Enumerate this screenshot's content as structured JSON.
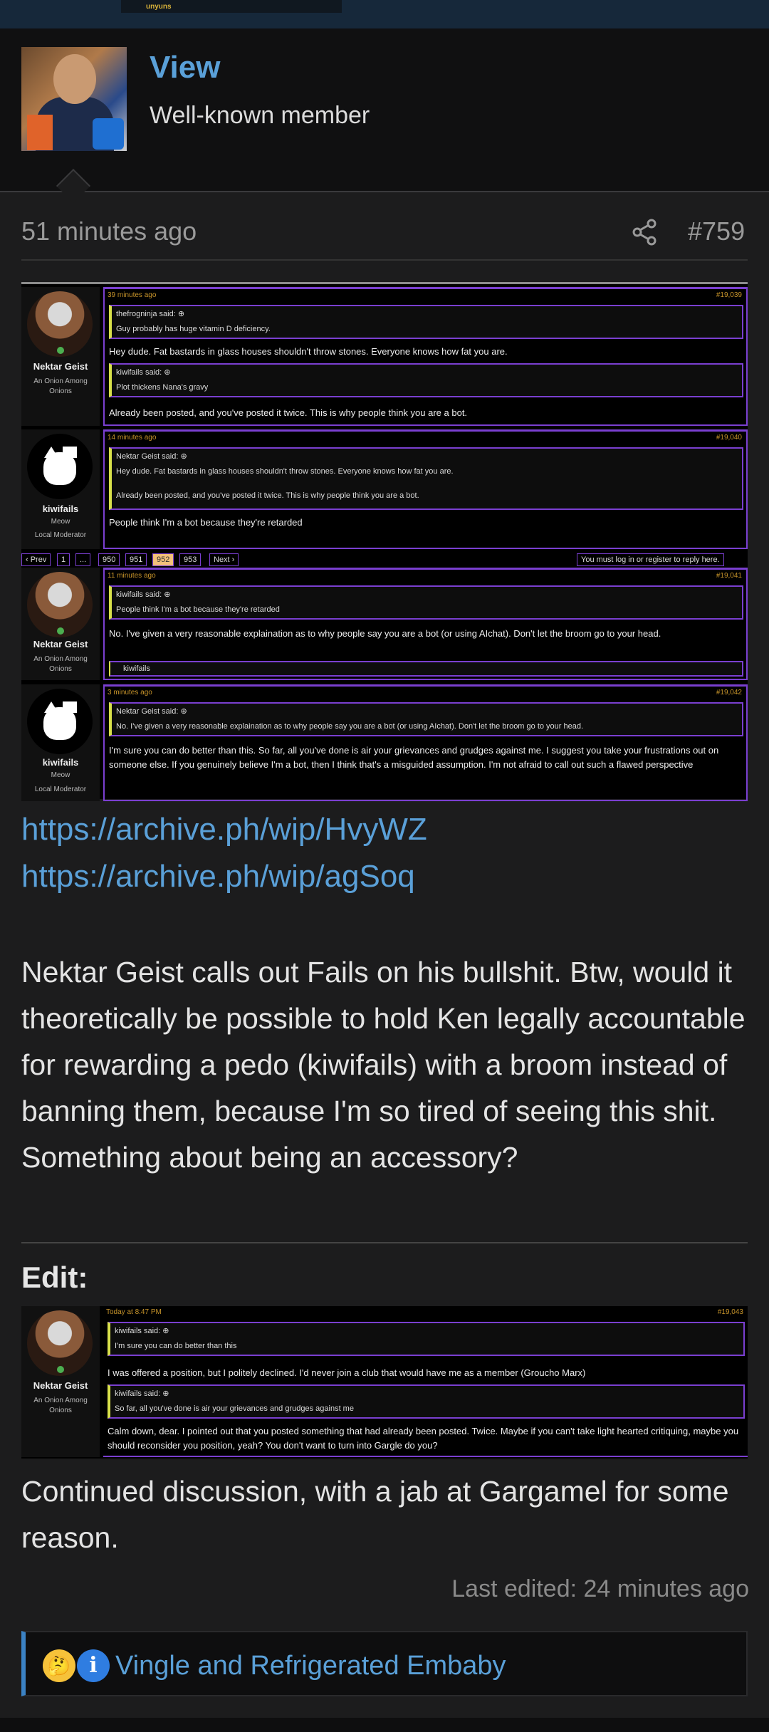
{
  "topstrip": {
    "tiny_text": "unyuns"
  },
  "member": {
    "name": "View",
    "title": "Well-known member"
  },
  "post": {
    "time": "51 minutes ago",
    "number": "#759"
  },
  "shot1": {
    "entries": [
      {
        "time": "39 minutes ago",
        "num": "#19,039",
        "user": "Nektar Geist",
        "user_title": "An Onion Among Onions",
        "q1_author": "thefrogninja said: ⊕",
        "q1_text": "Guy probably has huge vitamin D deficiency.",
        "t1": "Hey dude. Fat bastards in glass houses shouldn't throw stones. Everyone knows how fat you are.",
        "q2_author": "kiwifails said: ⊕",
        "q2_text": "Plot thickens Nana's gravy",
        "t2": "Already been posted, and you've posted it twice. This is why people think you are a bot."
      },
      {
        "time": "14 minutes ago",
        "num": "#19,040",
        "user": "kiwifails",
        "user_title": "Meow",
        "user_role": "Local Moderator",
        "q1_author": "Nektar Geist said: ⊕",
        "q1_text": "Hey dude. Fat bastards in glass houses shouldn't throw stones. Everyone knows how fat you are.",
        "q1_text2": "Already been posted, and you've posted it twice. This is why people think you are a bot.",
        "t1": "People think I'm a bot because they're retarded"
      }
    ],
    "pager": {
      "prev": "‹ Prev",
      "p1": "1",
      "dots": "...",
      "p950": "950",
      "p951": "951",
      "p952": "952",
      "p953": "953",
      "next": "Next ›",
      "notice": "You must log in or register to reply here."
    },
    "entries2": [
      {
        "time": "11 minutes ago",
        "num": "#19,041",
        "user": "Nektar Geist",
        "user_title": "An Onion Among Onions",
        "q1_author": "kiwifails said: ⊕",
        "q1_text": "People think I'm a bot because they're retarded",
        "t1": "No. I've given a very reasonable explaination as to why people say you are a bot (or using AIchat). Don't let the broom go to your head.",
        "react": "kiwifails"
      },
      {
        "time": "3 minutes ago",
        "num": "#19,042",
        "user": "kiwifails",
        "user_title": "Meow",
        "user_role": "Local Moderator",
        "q1_author": "Nektar Geist said: ⊕",
        "q1_text": "No. I've given a very reasonable explaination as to why people say you are a bot (or using AIchat). Don't let the broom go to your head.",
        "t1": "I'm sure you can do better than this. So far, all you've done is air your grievances and grudges against me. I suggest you take your frustrations out on someone else. If you genuinely believe I'm a bot, then I think that's a misguided assumption. I'm not afraid to call out such a flawed perspective"
      }
    ]
  },
  "links": [
    "https://archive.ph/wip/HvyWZ",
    "https://archive.ph/wip/agSoq"
  ],
  "body_text": "Nektar Geist calls out Fails on his bullshit. Btw, would it theoretically be possible to hold Ken legally accountable for rewarding a pedo (kiwifails) with a broom instead of banning them, because I'm so tired of seeing this shit. Something about being an accessory?",
  "edit_label": "Edit:",
  "shot2": {
    "time": "Today at 8:47 PM",
    "num": "#19,043",
    "user": "Nektar Geist",
    "user_title": "An Onion Among Onions",
    "q1_author": "kiwifails said: ⊕",
    "q1_text": "I'm sure you can do better than this",
    "t1": "I was offered a position, but I politely declined. I'd never join a club that would have me as a member (Groucho Marx)",
    "q2_author": "kiwifails said: ⊕",
    "q2_text": "So far, all you've done is air your grievances and grudges against me",
    "t2": "Calm down, dear. I pointed out that you posted something that had already been posted. Twice. Maybe if you can't take light hearted critiquing, maybe you should reconsider you position, yeah? You don't want to turn into Gargle do you?"
  },
  "body_text2": "Continued discussion, with a jab at Gargamel for some reason.",
  "last_edited": "Last edited: 24 minutes ago",
  "reactions": {
    "emoji1": "🤔",
    "emoji2": "i",
    "text": "Vingle and Refrigerated Embaby"
  },
  "colors": {
    "accent": "#5aa0d8",
    "embed_border": "#7a3fd0",
    "quote_bar": "#d8e04a",
    "time_gold": "#c6932a"
  }
}
